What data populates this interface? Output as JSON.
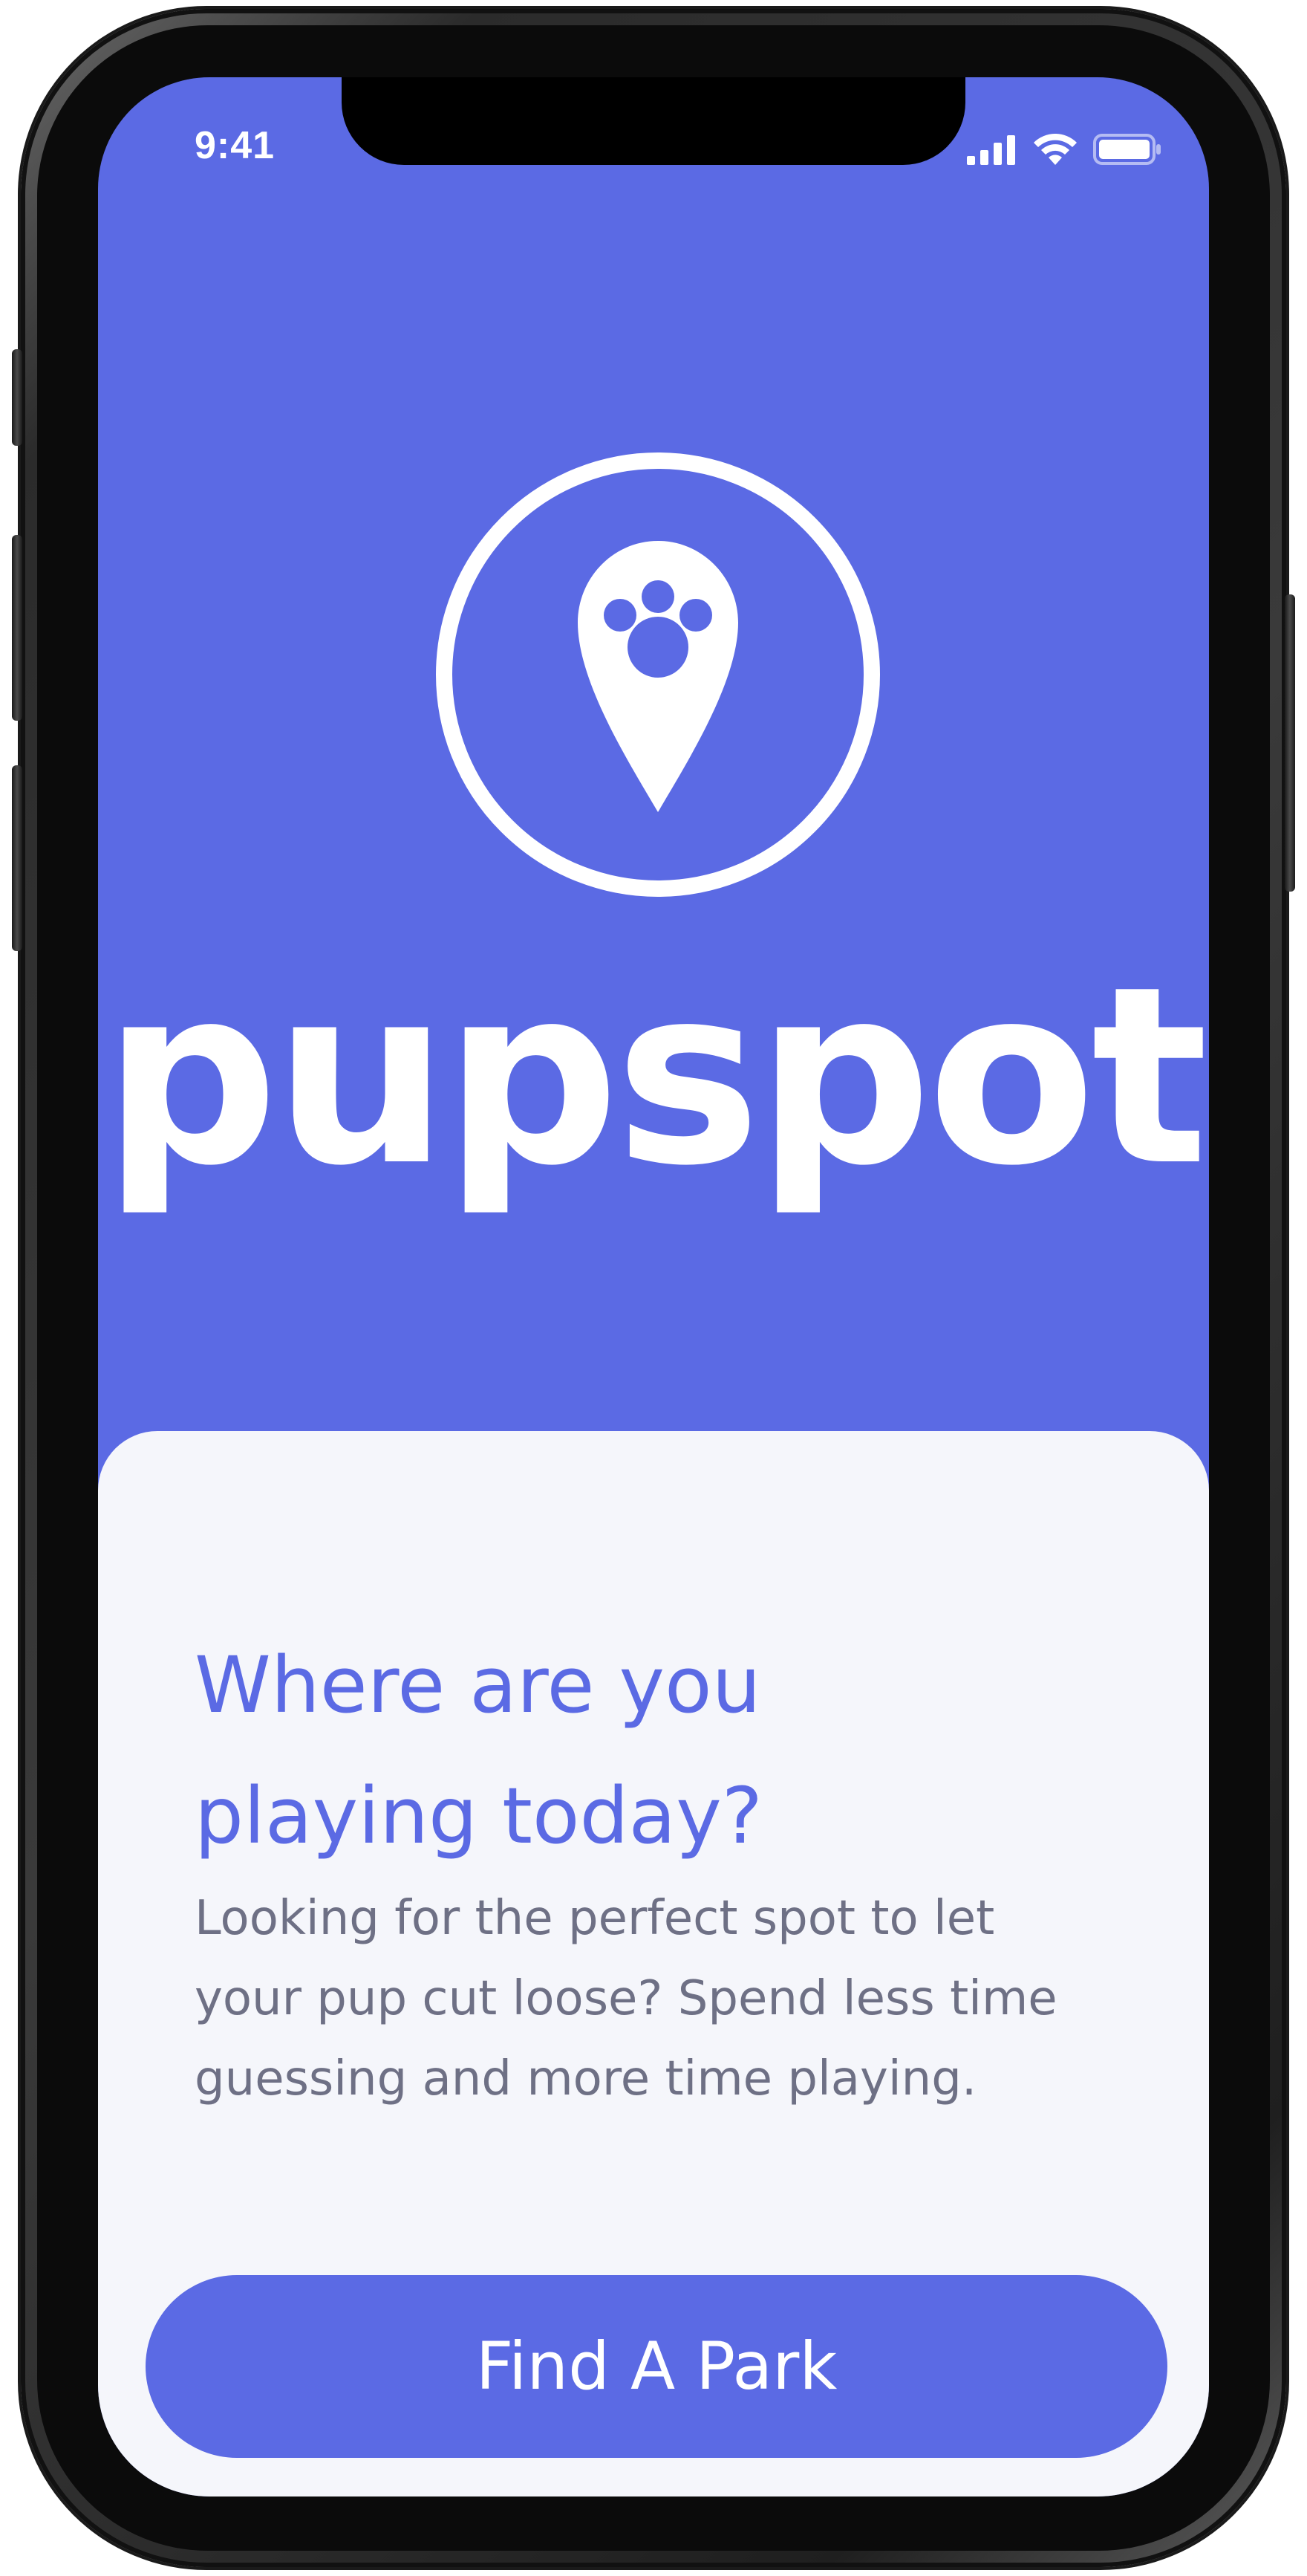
{
  "app": {
    "name": "pupspot"
  },
  "status_bar": {
    "time": "9:41",
    "icons": [
      "cellular-signal-icon",
      "wifi-icon",
      "battery-icon"
    ]
  },
  "hero": {
    "logo_icon": "paw-location-pin-icon",
    "brand_title": "pupspot"
  },
  "card": {
    "headline_line1": "Where are you",
    "headline_line2": "playing today?",
    "body_line1": "Looking for the perfect spot to let",
    "body_line2": "your pup cut loose? Spend less time",
    "body_line3": "guessing and more time playing.",
    "cta_label": "Find A Park"
  },
  "colors": {
    "brand": "#5B6AE4",
    "card_background": "#F5F6FB",
    "body_text": "#6E7085",
    "on_brand": "#FFFFFF"
  }
}
